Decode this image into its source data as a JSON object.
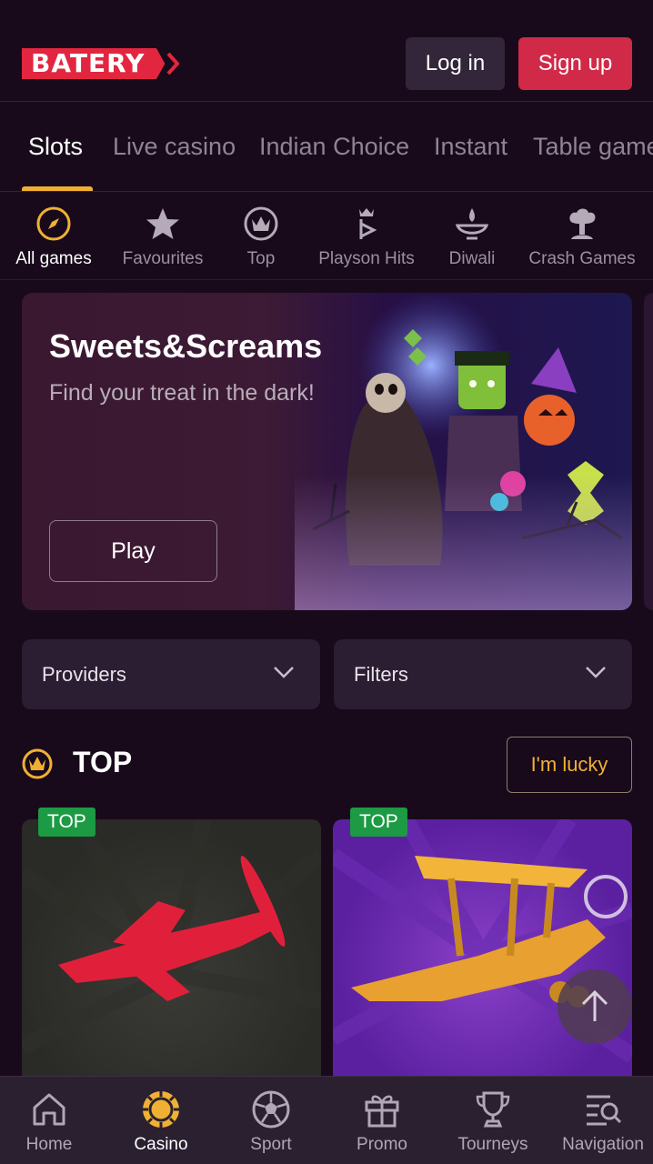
{
  "header": {
    "logo_text": "BATERY",
    "login_label": "Log in",
    "signup_label": "Sign up"
  },
  "tabs": [
    {
      "label": "Slots",
      "active": true
    },
    {
      "label": "Live casino"
    },
    {
      "label": "Indian Choice"
    },
    {
      "label": "Instant"
    },
    {
      "label": "Table games"
    }
  ],
  "categories": [
    {
      "label": "All games",
      "icon": "compass-icon",
      "active": true
    },
    {
      "label": "Favourites",
      "icon": "star-icon"
    },
    {
      "label": "Top",
      "icon": "crown-icon"
    },
    {
      "label": "Playson Hits",
      "icon": "playson-icon"
    },
    {
      "label": "Diwali",
      "icon": "diya-icon"
    },
    {
      "label": "Crash Games",
      "icon": "explosion-icon"
    }
  ],
  "banner": {
    "title": "Sweets&Screams",
    "subtitle": "Find your treat in the dark!",
    "play_label": "Play"
  },
  "filters": {
    "providers_label": "Providers",
    "filters_label": "Filters"
  },
  "top_section": {
    "title": "TOP",
    "lucky_label": "I'm lucky",
    "cards": [
      {
        "badge": "TOP",
        "icon": "red-plane-icon"
      },
      {
        "badge": "TOP",
        "icon": "gold-biplane-icon"
      }
    ]
  },
  "bottom_nav": [
    {
      "label": "Home",
      "icon": "home-icon"
    },
    {
      "label": "Casino",
      "icon": "casino-chip-icon",
      "active": true
    },
    {
      "label": "Sport",
      "icon": "soccer-ball-icon"
    },
    {
      "label": "Promo",
      "icon": "gift-icon"
    },
    {
      "label": "Tourneys",
      "icon": "trophy-icon"
    },
    {
      "label": "Navigation",
      "icon": "search-list-icon"
    }
  ],
  "colors": {
    "background": "#180a1b",
    "accent": "#f0b132",
    "brand_red": "#d12a48",
    "badge_green": "#1c9a44"
  }
}
